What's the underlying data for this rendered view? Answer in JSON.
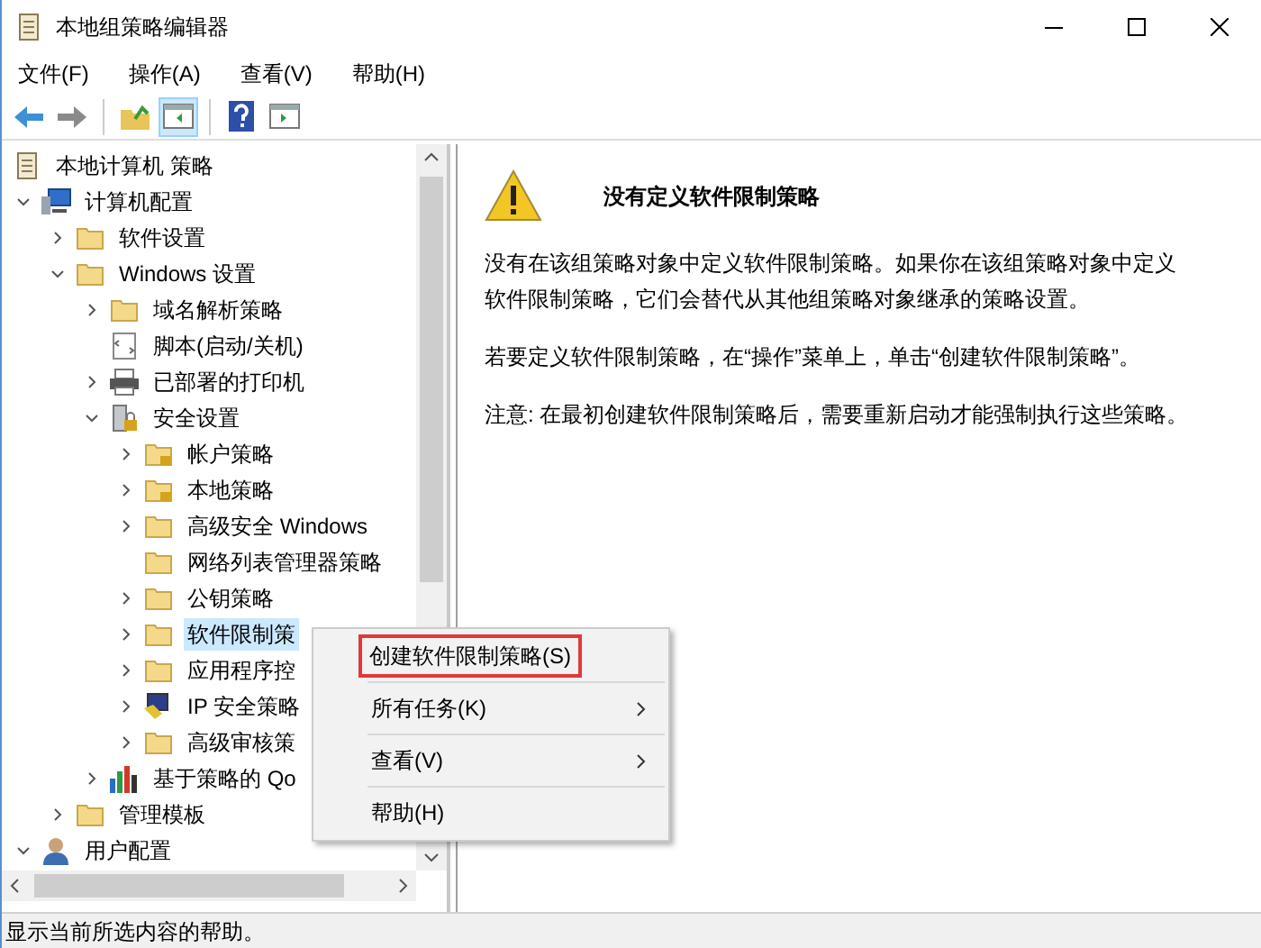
{
  "window": {
    "title": "本地组策略编辑器"
  },
  "menu": [
    "文件(F)",
    "操作(A)",
    "查看(V)",
    "帮助(H)"
  ],
  "toolbar": [
    {
      "kind": "back",
      "pressed": false
    },
    {
      "kind": "forward",
      "pressed": false
    },
    {
      "kind": "up",
      "pressed": false
    },
    {
      "kind": "tree",
      "pressed": true
    },
    {
      "kind": "help",
      "pressed": false
    },
    {
      "kind": "pane",
      "pressed": false
    }
  ],
  "tree": [
    {
      "label": "本地计算机 策略",
      "kind": "doc",
      "selected": false,
      "children": [
        {
          "label": "计算机配置",
          "kind": "computer",
          "expanded": true,
          "selected": false,
          "children": [
            {
              "label": "软件设置",
              "kind": "folder",
              "expanded": false,
              "selected": false
            },
            {
              "label": "Windows 设置",
              "kind": "folder",
              "expanded": true,
              "selected": false,
              "children": [
                {
                  "label": "域名解析策略",
                  "kind": "folder",
                  "expanded": false,
                  "selected": false
                },
                {
                  "label": "脚本(启动/关机)",
                  "kind": "script",
                  "selected": false
                },
                {
                  "label": "已部署的打印机",
                  "kind": "printer",
                  "expanded": false,
                  "selected": false
                },
                {
                  "label": "安全设置",
                  "kind": "lock",
                  "expanded": true,
                  "selected": false,
                  "children": [
                    {
                      "label": "帐户策略",
                      "kind": "lockfolder",
                      "expanded": false,
                      "selected": false
                    },
                    {
                      "label": "本地策略",
                      "kind": "lockfolder",
                      "expanded": false,
                      "selected": false
                    },
                    {
                      "label": "高级安全 Windows",
                      "kind": "folder",
                      "expanded": false,
                      "selected": false
                    },
                    {
                      "label": "网络列表管理器策略",
                      "kind": "folder",
                      "selected": false
                    },
                    {
                      "label": "公钥策略",
                      "kind": "folder",
                      "expanded": false,
                      "selected": false
                    },
                    {
                      "label": "软件限制策",
                      "kind": "folder",
                      "expanded": false,
                      "selected": true
                    },
                    {
                      "label": "应用程序控",
                      "kind": "folder",
                      "expanded": false,
                      "selected": false
                    },
                    {
                      "label": "IP 安全策略",
                      "kind": "shield",
                      "expanded": false,
                      "selected": false
                    },
                    {
                      "label": "高级审核策",
                      "kind": "folder",
                      "expanded": false,
                      "selected": false
                    }
                  ]
                },
                {
                  "label": "基于策略的 Qo",
                  "kind": "chart",
                  "expanded": false,
                  "selected": false
                }
              ]
            },
            {
              "label": "管理模板",
              "kind": "folder",
              "expanded": false,
              "selected": false
            }
          ]
        },
        {
          "label": "用户配置",
          "kind": "user",
          "expanded": true,
          "selected": false
        }
      ]
    }
  ],
  "context_menu": [
    {
      "label": "创建软件限制策略(S)",
      "highlighted": true,
      "submenu": false
    },
    {
      "label": "所有任务(K)",
      "highlighted": false,
      "submenu": true
    },
    {
      "label": "查看(V)",
      "highlighted": false,
      "submenu": true
    },
    {
      "label": "帮助(H)",
      "highlighted": false,
      "submenu": false
    }
  ],
  "detail": {
    "title": "没有定义软件限制策略",
    "paragraphs": [
      "没有在该组策略对象中定义软件限制策略。如果你在该组策略对象中定义软件限制策略，它们会替代从其他组策略对象继承的策略设置。",
      "若要定义软件限制策略，在“操作”菜单上，单击“创建软件限制策略”。",
      "注意: 在最初创建软件限制策略后，需要重新启动才能强制执行这些策略。"
    ]
  },
  "status_bar": "显示当前所选内容的帮助。"
}
